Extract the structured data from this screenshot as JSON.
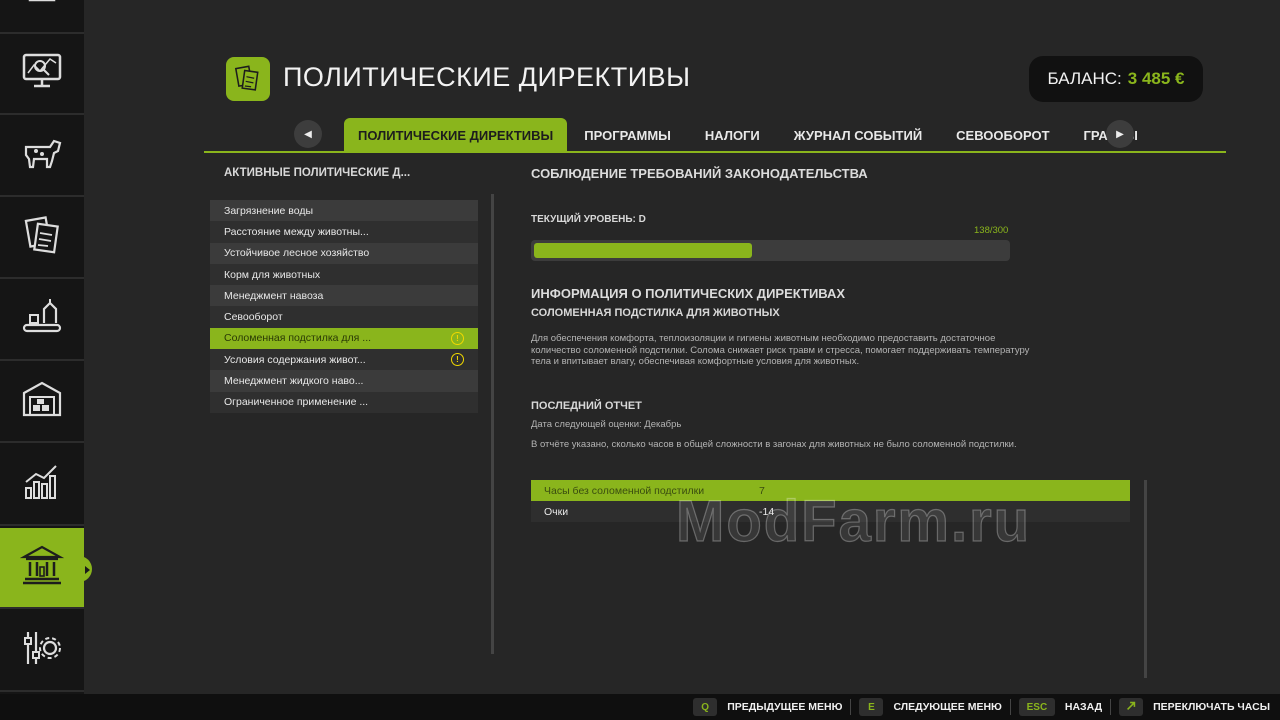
{
  "header": {
    "title": "ПОЛИТИЧЕСКИЕ ДИРЕКТИВЫ",
    "balance_label": "БАЛАНС:",
    "balance_value": "3 485 €"
  },
  "sidebar": {
    "items": [
      {
        "icon": "overview-icon"
      },
      {
        "icon": "map-icon"
      },
      {
        "icon": "animals-icon"
      },
      {
        "icon": "contracts-icon"
      },
      {
        "icon": "production-icon"
      },
      {
        "icon": "warehouse-icon"
      },
      {
        "icon": "statistics-icon"
      },
      {
        "icon": "government-icon",
        "active": true
      },
      {
        "icon": "settings-icon"
      }
    ]
  },
  "tabs": [
    {
      "label": "ПОЛИТИЧЕСКИЕ ДИРЕКТИВЫ",
      "active": true
    },
    {
      "label": "ПРОГРАММЫ"
    },
    {
      "label": "НАЛОГИ"
    },
    {
      "label": "ЖУРНАЛ СОБЫТИЙ"
    },
    {
      "label": "СЕВООБОРОТ"
    },
    {
      "label": "ГРАНТЫ"
    }
  ],
  "policies": {
    "title": "АКТИВНЫЕ ПОЛИТИЧЕСКИЕ Д...",
    "items": [
      {
        "label": "Загрязнение воды"
      },
      {
        "label": "Расстояние между животны..."
      },
      {
        "label": "Устойчивое лесное хозяйство"
      },
      {
        "label": "Корм для животных"
      },
      {
        "label": "Менеджмент навоза"
      },
      {
        "label": "Севооборот"
      },
      {
        "label": "Соломенная подстилка для ...",
        "selected": true,
        "warning": true
      },
      {
        "label": "Условия содержания живот...",
        "warning": true
      },
      {
        "label": "Менеджмент жидкого наво..."
      },
      {
        "label": "Ограниченное применение ..."
      }
    ]
  },
  "compliance": {
    "heading": "СОБЛЮДЕНИЕ ТРЕБОВАНИЙ ЗАКОНОДАТЕЛЬСТВА",
    "level_label": "ТЕКУЩИЙ УРОВЕНЬ: D",
    "progress_text": "138/300",
    "progress_current": 138,
    "progress_max": 300
  },
  "info": {
    "heading": "ИНФОРМАЦИЯ О ПОЛИТИЧЕСКИХ ДИРЕКТИВАХ",
    "policy_name": "СОЛОМЕННАЯ ПОДСТИЛКА ДЛЯ ЖИВОТНЫХ",
    "description_lines": [
      "Для обеспечения комфорта, теплоизоляции и гигиены животным необходимо предоставить достаточное",
      "количество соломенной подстилки. Солома снижает риск травм и стресса, помогает поддерживать температуру",
      "тела и впитывает влагу, обеспечивая комфортные условия для животных."
    ]
  },
  "report": {
    "heading": "ПОСЛЕДНИЙ ОТЧЕТ",
    "next_date": "Дата следующей оценки: Декабрь",
    "note": "В отчёте указано, сколько часов в общей сложности в загонах для животных не было соломенной подстилки.",
    "rows": [
      {
        "label": "Часы без соломенной подстилки",
        "value": "7"
      },
      {
        "label": "Очки",
        "value": "-14"
      }
    ]
  },
  "watermark": "ModFarm.ru",
  "footer": {
    "hints": [
      {
        "key": "Q",
        "label": "ПРЕДЫДУЩЕЕ МЕНЮ"
      },
      {
        "key": "E",
        "label": "СЛЕДУЮЩЕЕ МЕНЮ"
      },
      {
        "key": "ESC",
        "label": "НАЗАД"
      },
      {
        "key": "clock-key",
        "label": "ПЕРЕКЛЮЧАТЬ ЧАСЫ"
      }
    ]
  },
  "colors": {
    "accent": "#8ab51c",
    "background": "#262626",
    "sidebar": "#151515",
    "warning": "#f0d800"
  }
}
